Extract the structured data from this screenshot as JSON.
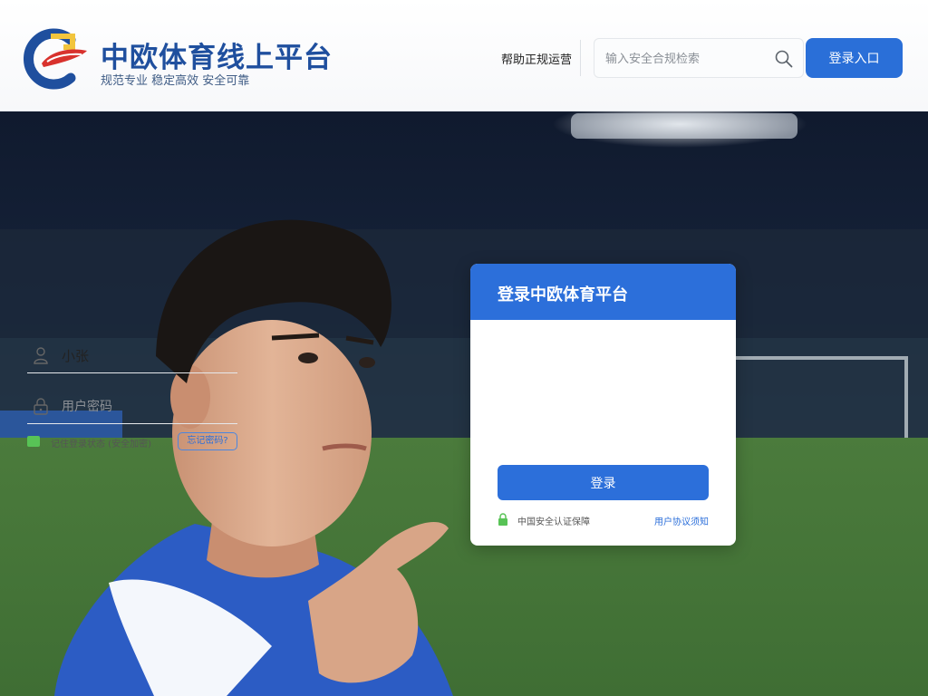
{
  "header": {
    "brand_title": "中欧体育线上平台",
    "brand_slogan": "规范专业 稳定高效 安全可靠",
    "nav_link": "帮助正规运营",
    "search": {
      "placeholder": "输入安全合规检索"
    },
    "login_button": "登录入口"
  },
  "login_card": {
    "title": "登录中欧体育平台",
    "username": {
      "value": "小张"
    },
    "password": {
      "placeholder": "用户密码"
    },
    "remember_text": "记住登录状态 (安全加密)",
    "forgot_link": "忘记密码?",
    "submit_label": "登录",
    "footer_left": "中国安全认证保障",
    "footer_right": "用户协议须知"
  },
  "colors": {
    "primary": "#2c6fda",
    "brand_text": "#1f4f9e",
    "logo_red": "#d8322d",
    "logo_yellow": "#f2c53d",
    "check_green": "#58c356"
  },
  "icons": [
    "logo-mark",
    "search-icon",
    "user-icon",
    "lock-icon",
    "checkbox-icon",
    "lock-green-icon"
  ]
}
